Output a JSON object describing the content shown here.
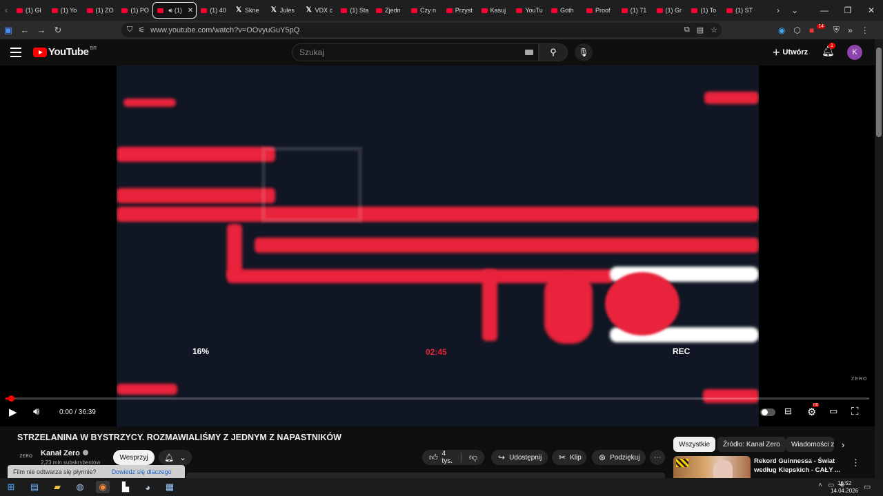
{
  "browser": {
    "tabs": [
      {
        "label": "(1) Gł",
        "icon": "youtube-icon"
      },
      {
        "label": "(1) Yo",
        "icon": "youtube-icon"
      },
      {
        "label": "(1) ZO",
        "icon": "youtube-icon"
      },
      {
        "label": "(1) PO",
        "icon": "youtube-icon"
      },
      {
        "label": "(1)",
        "icon": "youtube-icon",
        "active": true
      },
      {
        "label": "(1) 40",
        "icon": "youtube-icon"
      },
      {
        "label": "Skne",
        "icon": "x-icon"
      },
      {
        "label": "Jules",
        "icon": "x-icon"
      },
      {
        "label": "VDX c",
        "icon": "x-icon"
      },
      {
        "label": "(1) Sta",
        "icon": "youtube-icon"
      },
      {
        "label": "Zjedn",
        "icon": "youtube-icon"
      },
      {
        "label": "Czy n",
        "icon": "youtube-icon"
      },
      {
        "label": "Przyst",
        "icon": "youtube-icon"
      },
      {
        "label": "Kasuj",
        "icon": "youtube-icon"
      },
      {
        "label": "YouTu",
        "icon": "youtube-icon"
      },
      {
        "label": "Goth",
        "icon": "youtube-icon"
      },
      {
        "label": "Proof",
        "icon": "youtube-icon"
      },
      {
        "label": "(1) 71",
        "icon": "youtube-icon"
      },
      {
        "label": "(1) Gr",
        "icon": "youtube-icon"
      },
      {
        "label": "(1) To",
        "icon": "youtube-icon"
      },
      {
        "label": "(1) ST",
        "icon": "youtube-icon"
      }
    ],
    "url": "www.youtube.com/watch?v=OOvyuGuY5pQ",
    "extension_badge": "14"
  },
  "youtube": {
    "logo_text": "YouTube",
    "country_code": "BR",
    "search_placeholder": "Szukaj",
    "create_label": "Utwórz",
    "notification_count": "1",
    "avatar_letter": "K"
  },
  "player": {
    "overlay_percent": "16%",
    "overlay_timer": "02:45",
    "overlay_rec": "REC",
    "watermark": "ZERO",
    "current_time": "0:00",
    "duration": "36:39",
    "time_display": "0:00 / 36:39",
    "progress_fraction": 0.006,
    "quality_badge": "HD"
  },
  "video": {
    "title": "STRZELANINA W BYSTRZYCY. ROZMAWIALIŚMY Z JEDNYM Z NAPASTNIKÓW",
    "channel_name": "Kanał Zero",
    "channel_logo_text": "ZERO",
    "subscribers": "2,23 mln subskrybentów",
    "support_label": "Wesprzyj",
    "likes": "4 tys.",
    "share_label": "Udostępnij",
    "clip_label": "Klip",
    "thanks_label": "Podziękuj"
  },
  "toast": {
    "message": "Film nie odtwarza się płynnie?",
    "link": "Dowiedz się dlaczego"
  },
  "sidebar": {
    "chips": [
      "Wszystkie",
      "Źródło: Kanał Zero",
      "Wiadomości z"
    ],
    "recommendation_title": "Rekord Guinnessa - Świat według Kiepskich - CAŁY ..."
  },
  "taskbar": {
    "time": "16:52",
    "date": "14.04.2026"
  },
  "colors": {
    "youtube_red": "#ff0000",
    "video_red": "#e8233b",
    "timer_red": "#e8233b",
    "background": "#0f0f0f"
  }
}
